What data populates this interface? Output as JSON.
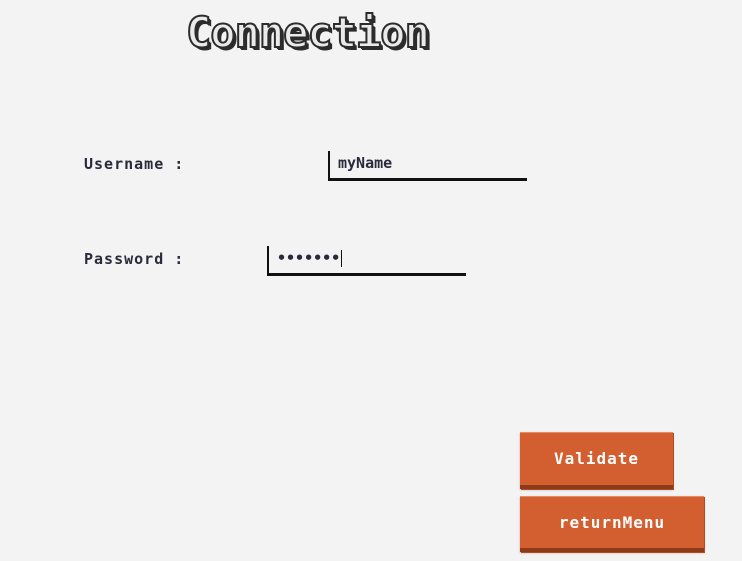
{
  "title": "Connection",
  "form": {
    "username_label": "Username :",
    "username_value": "myName",
    "password_label": "Password :",
    "password_masked_value": "•••••••"
  },
  "buttons": {
    "validate_label": "Validate",
    "return_label": "returnMenu"
  },
  "colors": {
    "background": "#f3f3f3",
    "button": "#d35e2f",
    "button_text": "#ffffff",
    "label_text": "#2a2a3a"
  }
}
